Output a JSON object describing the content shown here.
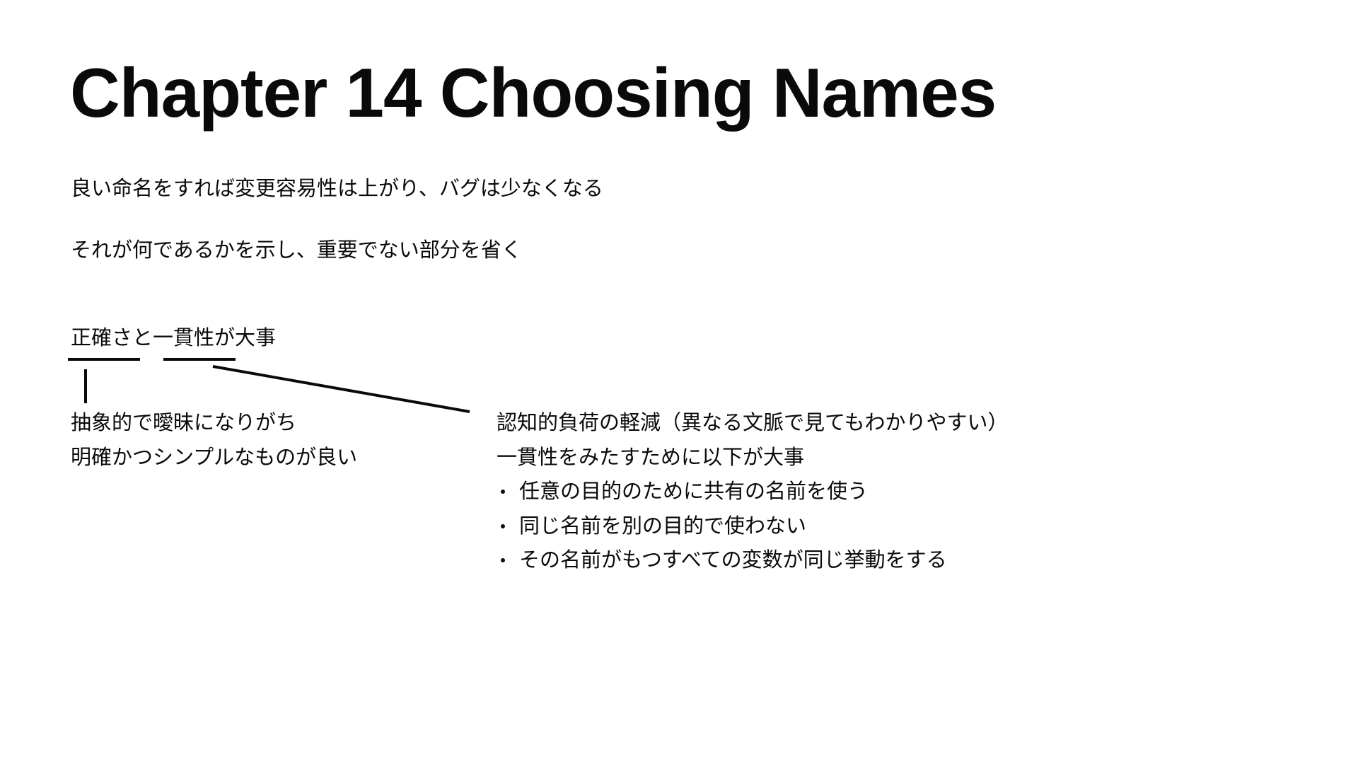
{
  "slide": {
    "title": "Chapter 14 Choosing Names",
    "intro_1": "良い命名をすれば変更容易性は上がり、バグは少なくなる",
    "intro_2": "それが何であるかを示し、重要でない部分を省く",
    "key_point": "正確さと一貫性が大事",
    "accuracy": {
      "line_1": "抽象的で曖昧になりがち",
      "line_2": "明確かつシンプルなものが良い"
    },
    "consistency": {
      "line_1": "認知的負荷の軽減（異なる文脈で見てもわかりやすい）",
      "line_2": "一貫性をみたすために以下が大事",
      "bullets": [
        "任意の目的のために共有の名前を使う",
        "同じ名前を別の目的で使わない",
        "その名前がもつすべての変数が同じ挙動をする"
      ]
    }
  }
}
